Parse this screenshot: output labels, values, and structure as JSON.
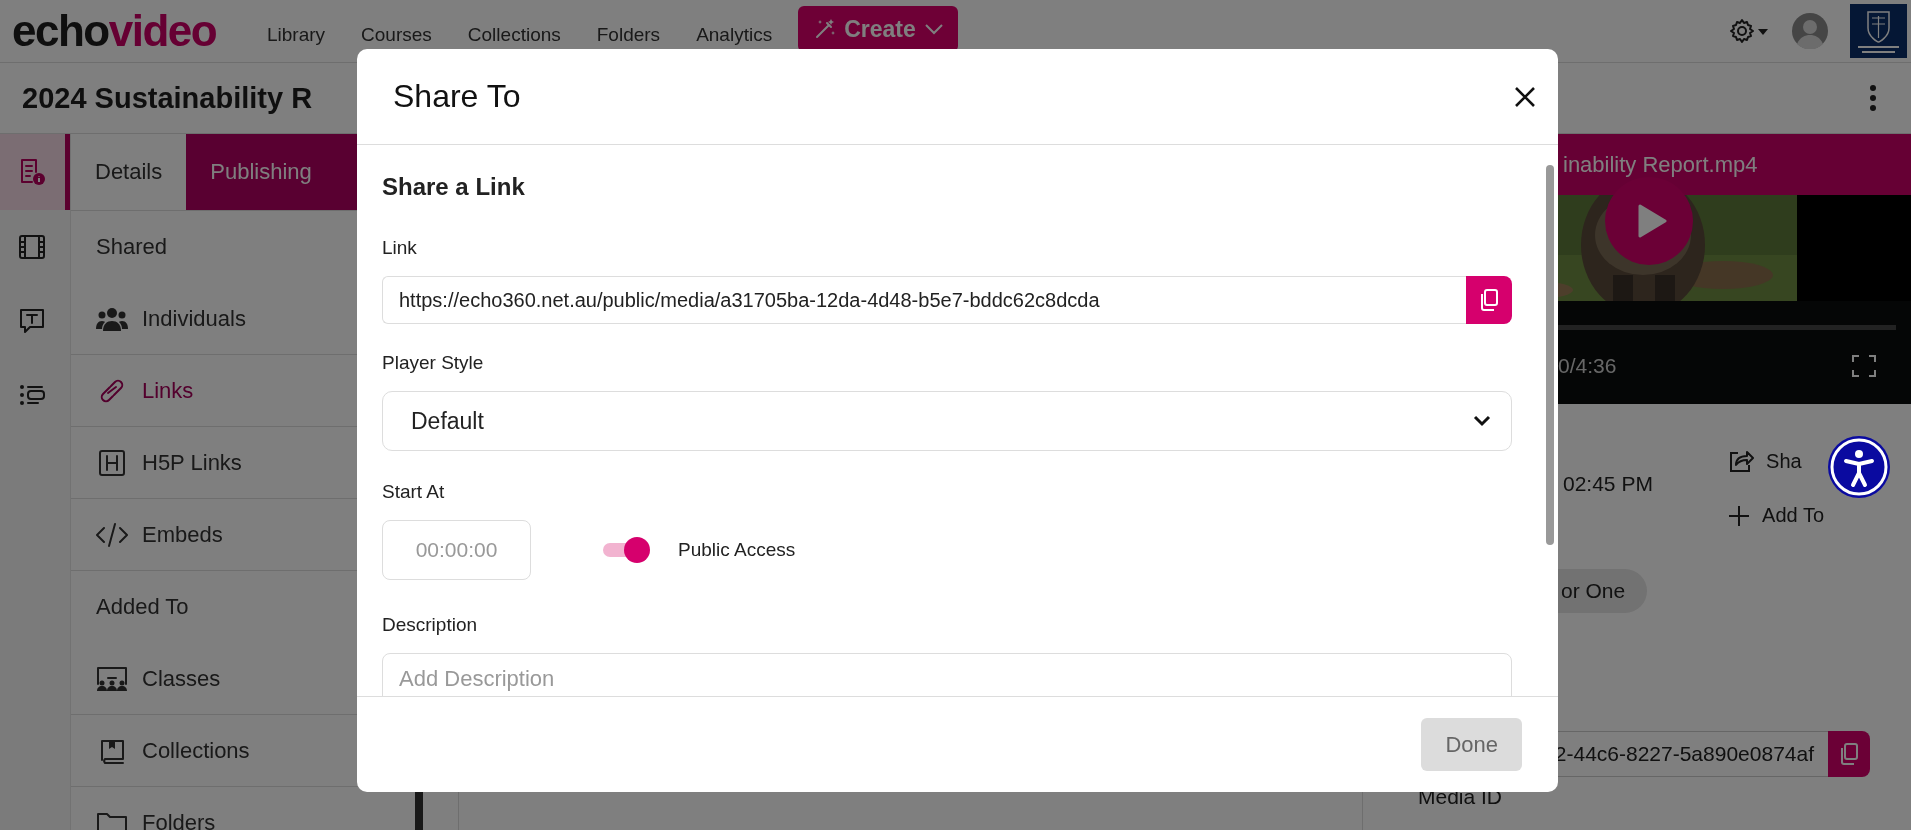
{
  "header": {
    "logo_part_1": "echo",
    "logo_part_2": "video",
    "nav": [
      "Library",
      "Courses",
      "Collections",
      "Folders",
      "Analytics"
    ],
    "create_button": "Create"
  },
  "page_title": "2024 Sustainability R",
  "rail": [
    {
      "selected": true
    },
    {
      "selected": false
    },
    {
      "selected": false
    },
    {
      "selected": false
    }
  ],
  "tabs": [
    {
      "label": "Details",
      "selected": false
    },
    {
      "label": "Publishing",
      "selected": true
    }
  ],
  "sidebar": [
    {
      "kind": "heading",
      "label": "Shared"
    },
    {
      "kind": "item",
      "label": "Individuals",
      "selected": false
    },
    {
      "kind": "item",
      "label": "Links",
      "selected": true
    },
    {
      "kind": "item",
      "label": "H5P Links",
      "selected": false
    },
    {
      "kind": "item",
      "label": "Embeds",
      "selected": false
    },
    {
      "kind": "heading",
      "label": "Added To"
    },
    {
      "kind": "item",
      "label": "Classes",
      "selected": false
    },
    {
      "kind": "item",
      "label": "Collections",
      "selected": false
    },
    {
      "kind": "item",
      "label": "Folders",
      "selected": false
    }
  ],
  "video": {
    "title": "inability Report.mp4",
    "time": "0/4:36"
  },
  "details": {
    "time": "02:45 PM",
    "share": "Sha",
    "add_to": "Add To",
    "tag": "or One",
    "media_id_value": "2-44c6-8227-5a890e0874af",
    "media_id_label": "Media ID"
  },
  "modal": {
    "title": "Share To",
    "section": "Share a Link",
    "link_label": "Link",
    "link": "https://echo360.net.au/public/media/a31705ba-12da-4d48-b5e7-bddc62c8dcda",
    "player_style_label": "Player Style",
    "player_style": "Default",
    "start_label": "Start At",
    "start_placeholder": "00:00:00",
    "public_access": {
      "label": "Public Access",
      "on": true
    },
    "description_label": "Description",
    "description_placeholder": "Add Description",
    "done_button": {
      "label": "Done",
      "disabled": true
    }
  }
}
